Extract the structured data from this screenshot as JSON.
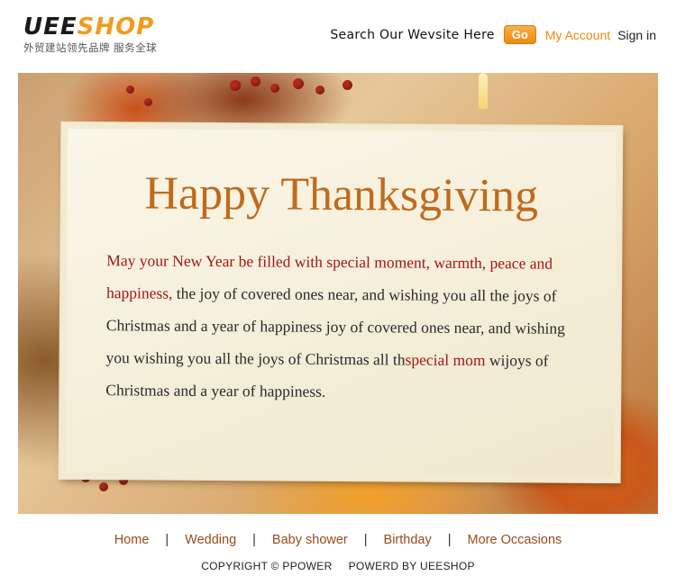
{
  "header": {
    "logo": {
      "part1": "UEE",
      "part2": "SHOP",
      "tagline": "外贸建站领先品牌 服务全球"
    },
    "search_text": "Search Our Wevsite Here",
    "go_label": "Go",
    "account_label": "My Account",
    "signin_label": "Sign in"
  },
  "card": {
    "title": "Happy Thanksgiving",
    "body": {
      "hl1": "May your New Year be filled with special moment, warmth, peace and happiness,",
      "text1": " the joy of covered ones near, and wishing you all the joys of Christmas and a year of happiness joy of covered ones near, and wishing you wishing you all the joys of Christmas all th",
      "hl2": "special mom",
      "text2": " wijoys of Christmas and a year of happiness."
    }
  },
  "footer": {
    "nav": [
      "Home",
      "Wedding",
      "Baby shower",
      "Birthday",
      "More Occasions"
    ],
    "separator": "|",
    "copyright": "COPYRIGHT © PPOWER",
    "powered": "POWERD BY UEESHOP"
  },
  "colors": {
    "accent": "#ee8a10",
    "title": "#c06a1c",
    "highlight": "#a31616",
    "footer_link": "#9b4a1b"
  }
}
